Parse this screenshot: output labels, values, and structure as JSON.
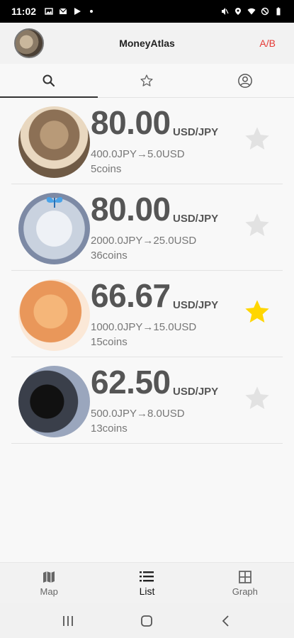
{
  "status_bar": {
    "time": "11:02"
  },
  "app_bar": {
    "title": "MoneyAtlas",
    "ab_label": "A/B"
  },
  "tabs": [
    {
      "name": "search",
      "icon": "search-icon",
      "active": true
    },
    {
      "name": "favorites",
      "icon": "star-outline-icon",
      "active": false
    },
    {
      "name": "account",
      "icon": "account-icon",
      "active": false
    }
  ],
  "list": [
    {
      "rate": "80.00",
      "unit": "USD/JPY",
      "conversion": "400.0JPY→5.0USD",
      "coins": "5coins",
      "favorite": false
    },
    {
      "rate": "80.00",
      "unit": "USD/JPY",
      "conversion": "2000.0JPY→25.0USD",
      "coins": "36coins",
      "favorite": false
    },
    {
      "rate": "66.67",
      "unit": "USD/JPY",
      "conversion": "1000.0JPY→15.0USD",
      "coins": "15coins",
      "favorite": true
    },
    {
      "rate": "62.50",
      "unit": "USD/JPY",
      "conversion": "500.0JPY→8.0USD",
      "coins": "13coins",
      "favorite": false
    }
  ],
  "bottom_nav": {
    "map": "Map",
    "list": "List",
    "graph": "Graph"
  },
  "colors": {
    "accent_red": "#e53935",
    "star_active": "#ffd600",
    "star_inactive": "#e0e0e0"
  }
}
